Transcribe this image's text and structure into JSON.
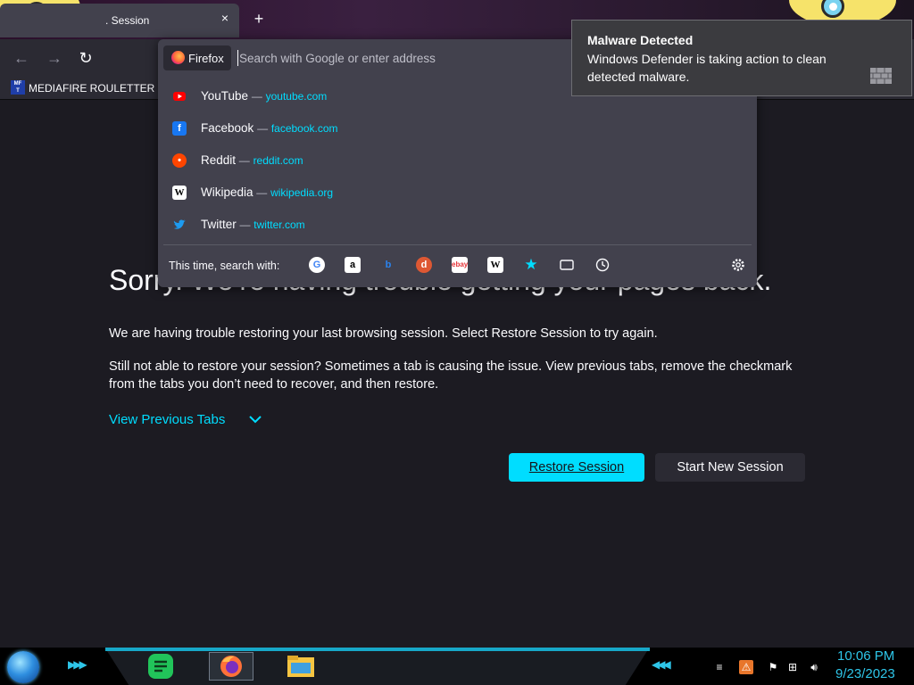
{
  "tab": {
    "title": ". Session",
    "close": "×",
    "new_tab": "+"
  },
  "bookmarks": [
    {
      "label": "MEDIAFIRE ROULETTER",
      "icon_text": "MF\nT"
    }
  ],
  "urlbar": {
    "engine_chip": "Firefox",
    "placeholder": "Search with Google or enter address",
    "results": [
      {
        "title": "YouTube",
        "url": "youtube.com",
        "icon": "youtube-icon",
        "color": "#ff0000"
      },
      {
        "title": "Facebook",
        "url": "facebook.com",
        "icon": "facebook-icon",
        "color": "#1877f2"
      },
      {
        "title": "Reddit",
        "url": "reddit.com",
        "icon": "reddit-icon",
        "color": "#ff4500"
      },
      {
        "title": "Wikipedia",
        "url": "wikipedia.org",
        "icon": "wikipedia-icon",
        "color": "#ffffff"
      },
      {
        "title": "Twitter",
        "url": "twitter.com",
        "icon": "twitter-icon",
        "color": "#1d9bf0"
      }
    ],
    "search_with_label": "This time, search with:",
    "engines": [
      "google-icon",
      "amazon-icon",
      "bing-icon",
      "duckduckgo-icon",
      "ebay-icon",
      "wikipedia-icon",
      "bookmarks-icon",
      "tabs-icon",
      "history-icon",
      "settings-icon"
    ]
  },
  "error_page": {
    "title": "Sorry. We’re having trouble getting your pages back.",
    "p1": "We are having trouble restoring your last browsing session. Select Restore Session to try again.",
    "p2": "Still not able to restore your session? Sometimes a tab is causing the issue. View previous tabs, remove the checkmark from the tabs you don’t need to recover, and then restore.",
    "view_previous": "View Previous Tabs",
    "restore_button": "Restore Session",
    "new_session_button": "Start New Session"
  },
  "notification": {
    "title": "Malware Detected",
    "body": "Windows Defender is taking action to clean detected malware."
  },
  "taskbar": {
    "apps": [
      "sheets-icon",
      "firefox-icon",
      "file-explorer-icon"
    ],
    "time": "10:06 PM",
    "date": "9/23/2023"
  },
  "colors": {
    "accent": "#00ddff",
    "page_bg": "#1c1b22",
    "panel_bg": "#42414d",
    "clock": "#2ec5e8"
  }
}
